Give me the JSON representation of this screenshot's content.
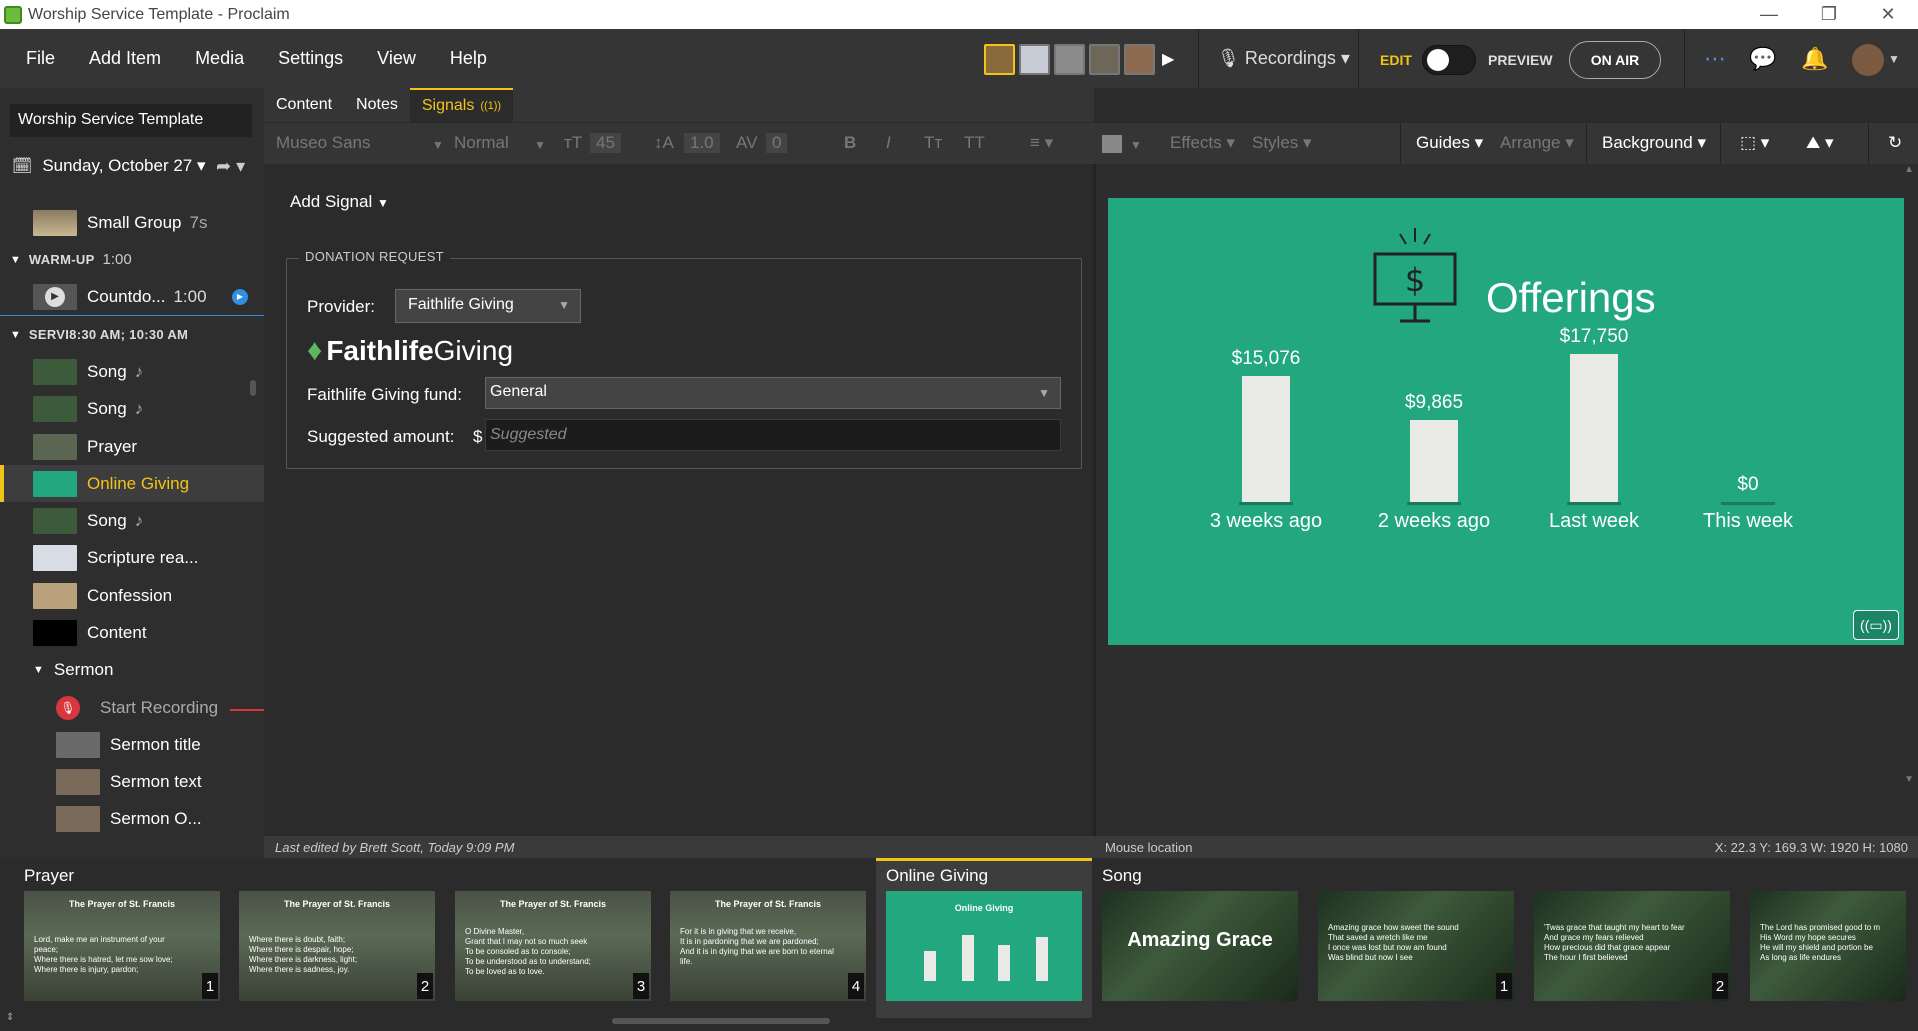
{
  "window": {
    "title": "Worship Service Template - Proclaim"
  },
  "menu": [
    "File",
    "Add Item",
    "Media",
    "Settings",
    "View",
    "Help"
  ],
  "top": {
    "recordings": "Recordings ▾",
    "edit": "EDIT",
    "preview": "PREVIEW",
    "on_air": "ON AIR"
  },
  "left": {
    "doc_title": "Worship Service Template",
    "date": "Sunday, October 27 ▾",
    "items": [
      {
        "label": "Small Group",
        "dur": "7s"
      },
      {
        "label": "WARM-UP",
        "dur": "1:00"
      },
      {
        "label": "Countdo...",
        "dur": "1:00"
      },
      {
        "label": "SERVI8:30 AM; 10:30 AM"
      },
      {
        "label": "Song",
        "note": "♪"
      },
      {
        "label": "Song",
        "note": "♪"
      },
      {
        "label": "Prayer"
      },
      {
        "label": "Online Giving"
      },
      {
        "label": "Song",
        "note": "♪"
      },
      {
        "label": "Scripture rea..."
      },
      {
        "label": "Confession"
      },
      {
        "label": "Content"
      },
      {
        "label": "Sermon"
      },
      {
        "label": "Start Recording"
      },
      {
        "label": "Sermon title"
      },
      {
        "label": "Sermon text"
      },
      {
        "label": "Sermon O..."
      }
    ]
  },
  "tabs": {
    "content": "Content",
    "notes": "Notes",
    "signals": "Signals",
    "signals_badge": "((1))"
  },
  "toolbar": {
    "font": "Museo Sans",
    "weight": "Normal",
    "size": "45",
    "line": "1.0",
    "kern": "0",
    "effects": "Effects",
    "styles": "Styles",
    "guides": "Guides",
    "arrange": "Arrange",
    "background": "Background"
  },
  "signal": {
    "add_signal": "Add Signal",
    "legend": "DONATION REQUEST",
    "provider_label": "Provider:",
    "provider_value": "Faithlife Giving",
    "logo_a": "Faithlife",
    "logo_b": "Giving",
    "fund_label": "Faithlife Giving fund:",
    "fund_value": "General",
    "amount_label": "Suggested amount:",
    "currency": "$",
    "amount_placeholder": "Suggested"
  },
  "status": {
    "left": "Last edited by Brett Scott, Today 9:09 PM",
    "mouse": "Mouse location",
    "coords": "X: 22.3  Y: 169.3   W: 1920  H: 1080"
  },
  "slide": {
    "title": "Offerings",
    "chart_data": {
      "type": "bar",
      "categories": [
        "3 weeks ago",
        "2 weeks ago",
        "Last week",
        "This week"
      ],
      "values": [
        15076,
        9865,
        17750,
        0
      ],
      "value_labels": [
        "$15,076",
        "$9,865",
        "$17,750",
        "$0"
      ]
    }
  },
  "strip": {
    "groups": [
      "Prayer",
      "Online Giving",
      "Song"
    ],
    "prayer_title": "The Prayer of St. Francis",
    "prayer_slides": [
      "Lord, make me an instrument of your\npeace;\nWhere there is hatred, let me sow love;\nWhere there is injury, pardon;",
      "Where there is doubt, faith;\nWhere there is despair, hope;\nWhere there is darkness, light;\nWhere there is sadness, joy.",
      "O Divine Master,\nGrant that I may not so much seek\nTo be consoled as to console;\nTo be understood as to understand;\nTo be loved as to love.",
      "For it is in giving that we receive,\nIt is in pardoning that we are pardoned;\nAnd it is in dying that we are born to eternal\nlife."
    ],
    "prayer_nums": [
      "1",
      "2",
      "3",
      "4"
    ],
    "online_giving_title": "Online Giving",
    "song_title": "Amazing Grace",
    "song_slides": [
      "Amazing grace how sweet the sound\nThat saved a wretch like me\nI once was lost but now am found\nWas blind but now I see",
      "'Twas grace that taught my heart to fear\nAnd grace my fears relieved\nHow precious did that grace appear\nThe hour I first believed",
      "The Lord has promised good to m\nHis Word my hope secures\nHe will my shield and portion be\nAs long as life endures"
    ],
    "song_nums": [
      "1",
      "2"
    ]
  }
}
